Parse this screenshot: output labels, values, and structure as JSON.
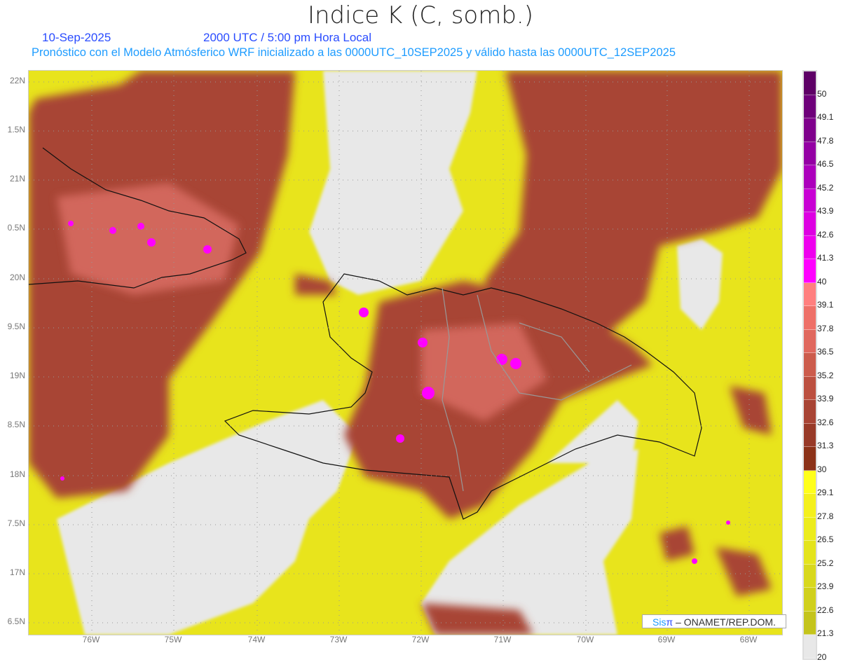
{
  "title": "Indice K (C, somb.)",
  "date": "10-Sep-2025",
  "time": "2000 UTC / 5:00 pm Hora Local",
  "subtitle": "Pronóstico con el Modelo Atmósferico WRF inicializado a las 0000UTC_10SEP2025 y válido hasta las  0000UTC_12SEP2025",
  "lat_labels": [
    "22N",
    "1.5N",
    "21N",
    "0.5N",
    "20N",
    "9.5N",
    "19N",
    "8.5N",
    "18N",
    "7.5N",
    "17N",
    "6.5N"
  ],
  "lon_labels": [
    "76W",
    "75W",
    "74W",
    "73W",
    "72W",
    "71W",
    "70W",
    "69W",
    "68W"
  ],
  "colorbar": {
    "labels": [
      "50",
      "49.1",
      "47.8",
      "46.5",
      "45.2",
      "43.9",
      "42.6",
      "41.3",
      "40",
      "39.1",
      "37.8",
      "36.5",
      "35.2",
      "33.9",
      "32.6",
      "31.3",
      "30",
      "29.1",
      "27.8",
      "26.5",
      "25.2",
      "23.9",
      "22.6",
      "21.3",
      "20"
    ],
    "colors": [
      "#5e0066",
      "#6e007a",
      "#7f008c",
      "#9400a4",
      "#ac00bc",
      "#c800d4",
      "#dd00e2",
      "#ee00ee",
      "#ff00ff",
      "#ff7f7f",
      "#ee7068",
      "#e0685e",
      "#cc5c4c",
      "#bc5040",
      "#a84434",
      "#983a28",
      "#8c3218",
      "#ffff1a",
      "#f4f01c",
      "#ecec1c",
      "#e4e41c",
      "#d8d81c",
      "#d0d01c",
      "#c4c41c",
      "#e8e8e8"
    ]
  },
  "credit": {
    "brand_a": "Sis",
    "brand_b": "π",
    "text": "–  ONAMET/REP.DOM."
  }
}
